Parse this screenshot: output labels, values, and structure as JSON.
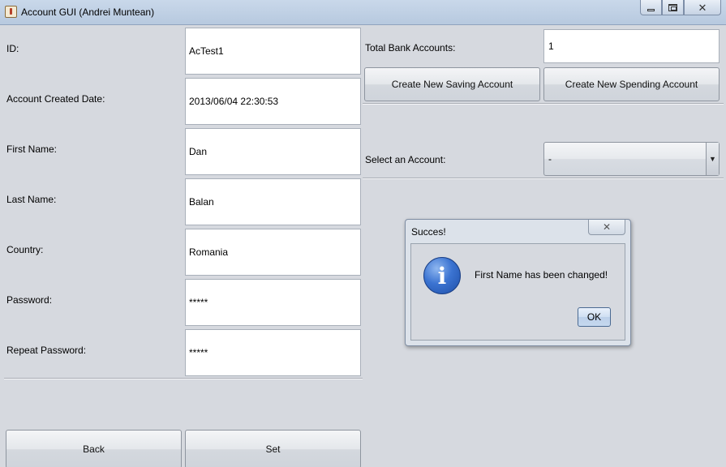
{
  "window": {
    "title": "Account GUI (Andrei Muntean)"
  },
  "form": {
    "fields": [
      {
        "label": "ID:",
        "value": "AcTest1"
      },
      {
        "label": "Account Created Date:",
        "value": "2013/06/04 22:30:53"
      },
      {
        "label": "First Name:",
        "value": "Dan"
      },
      {
        "label": "Last Name:",
        "value": "Balan"
      },
      {
        "label": "Country:",
        "value": "Romania"
      },
      {
        "label": "Password:",
        "value": "*****"
      },
      {
        "label": "Repeat Password:",
        "value": "*****"
      }
    ],
    "back_label": "Back",
    "set_label": "Set"
  },
  "accounts": {
    "total_label": "Total Bank Accounts:",
    "total_value": "1",
    "new_saving_label": "Create New Saving Account",
    "new_spending_label": "Create New Spending Account",
    "select_label": "Select an Account:",
    "select_value": "-"
  },
  "dialog": {
    "title": "Succes!",
    "message": "First Name has been changed!",
    "ok_label": "OK",
    "icon": "info-icon"
  }
}
